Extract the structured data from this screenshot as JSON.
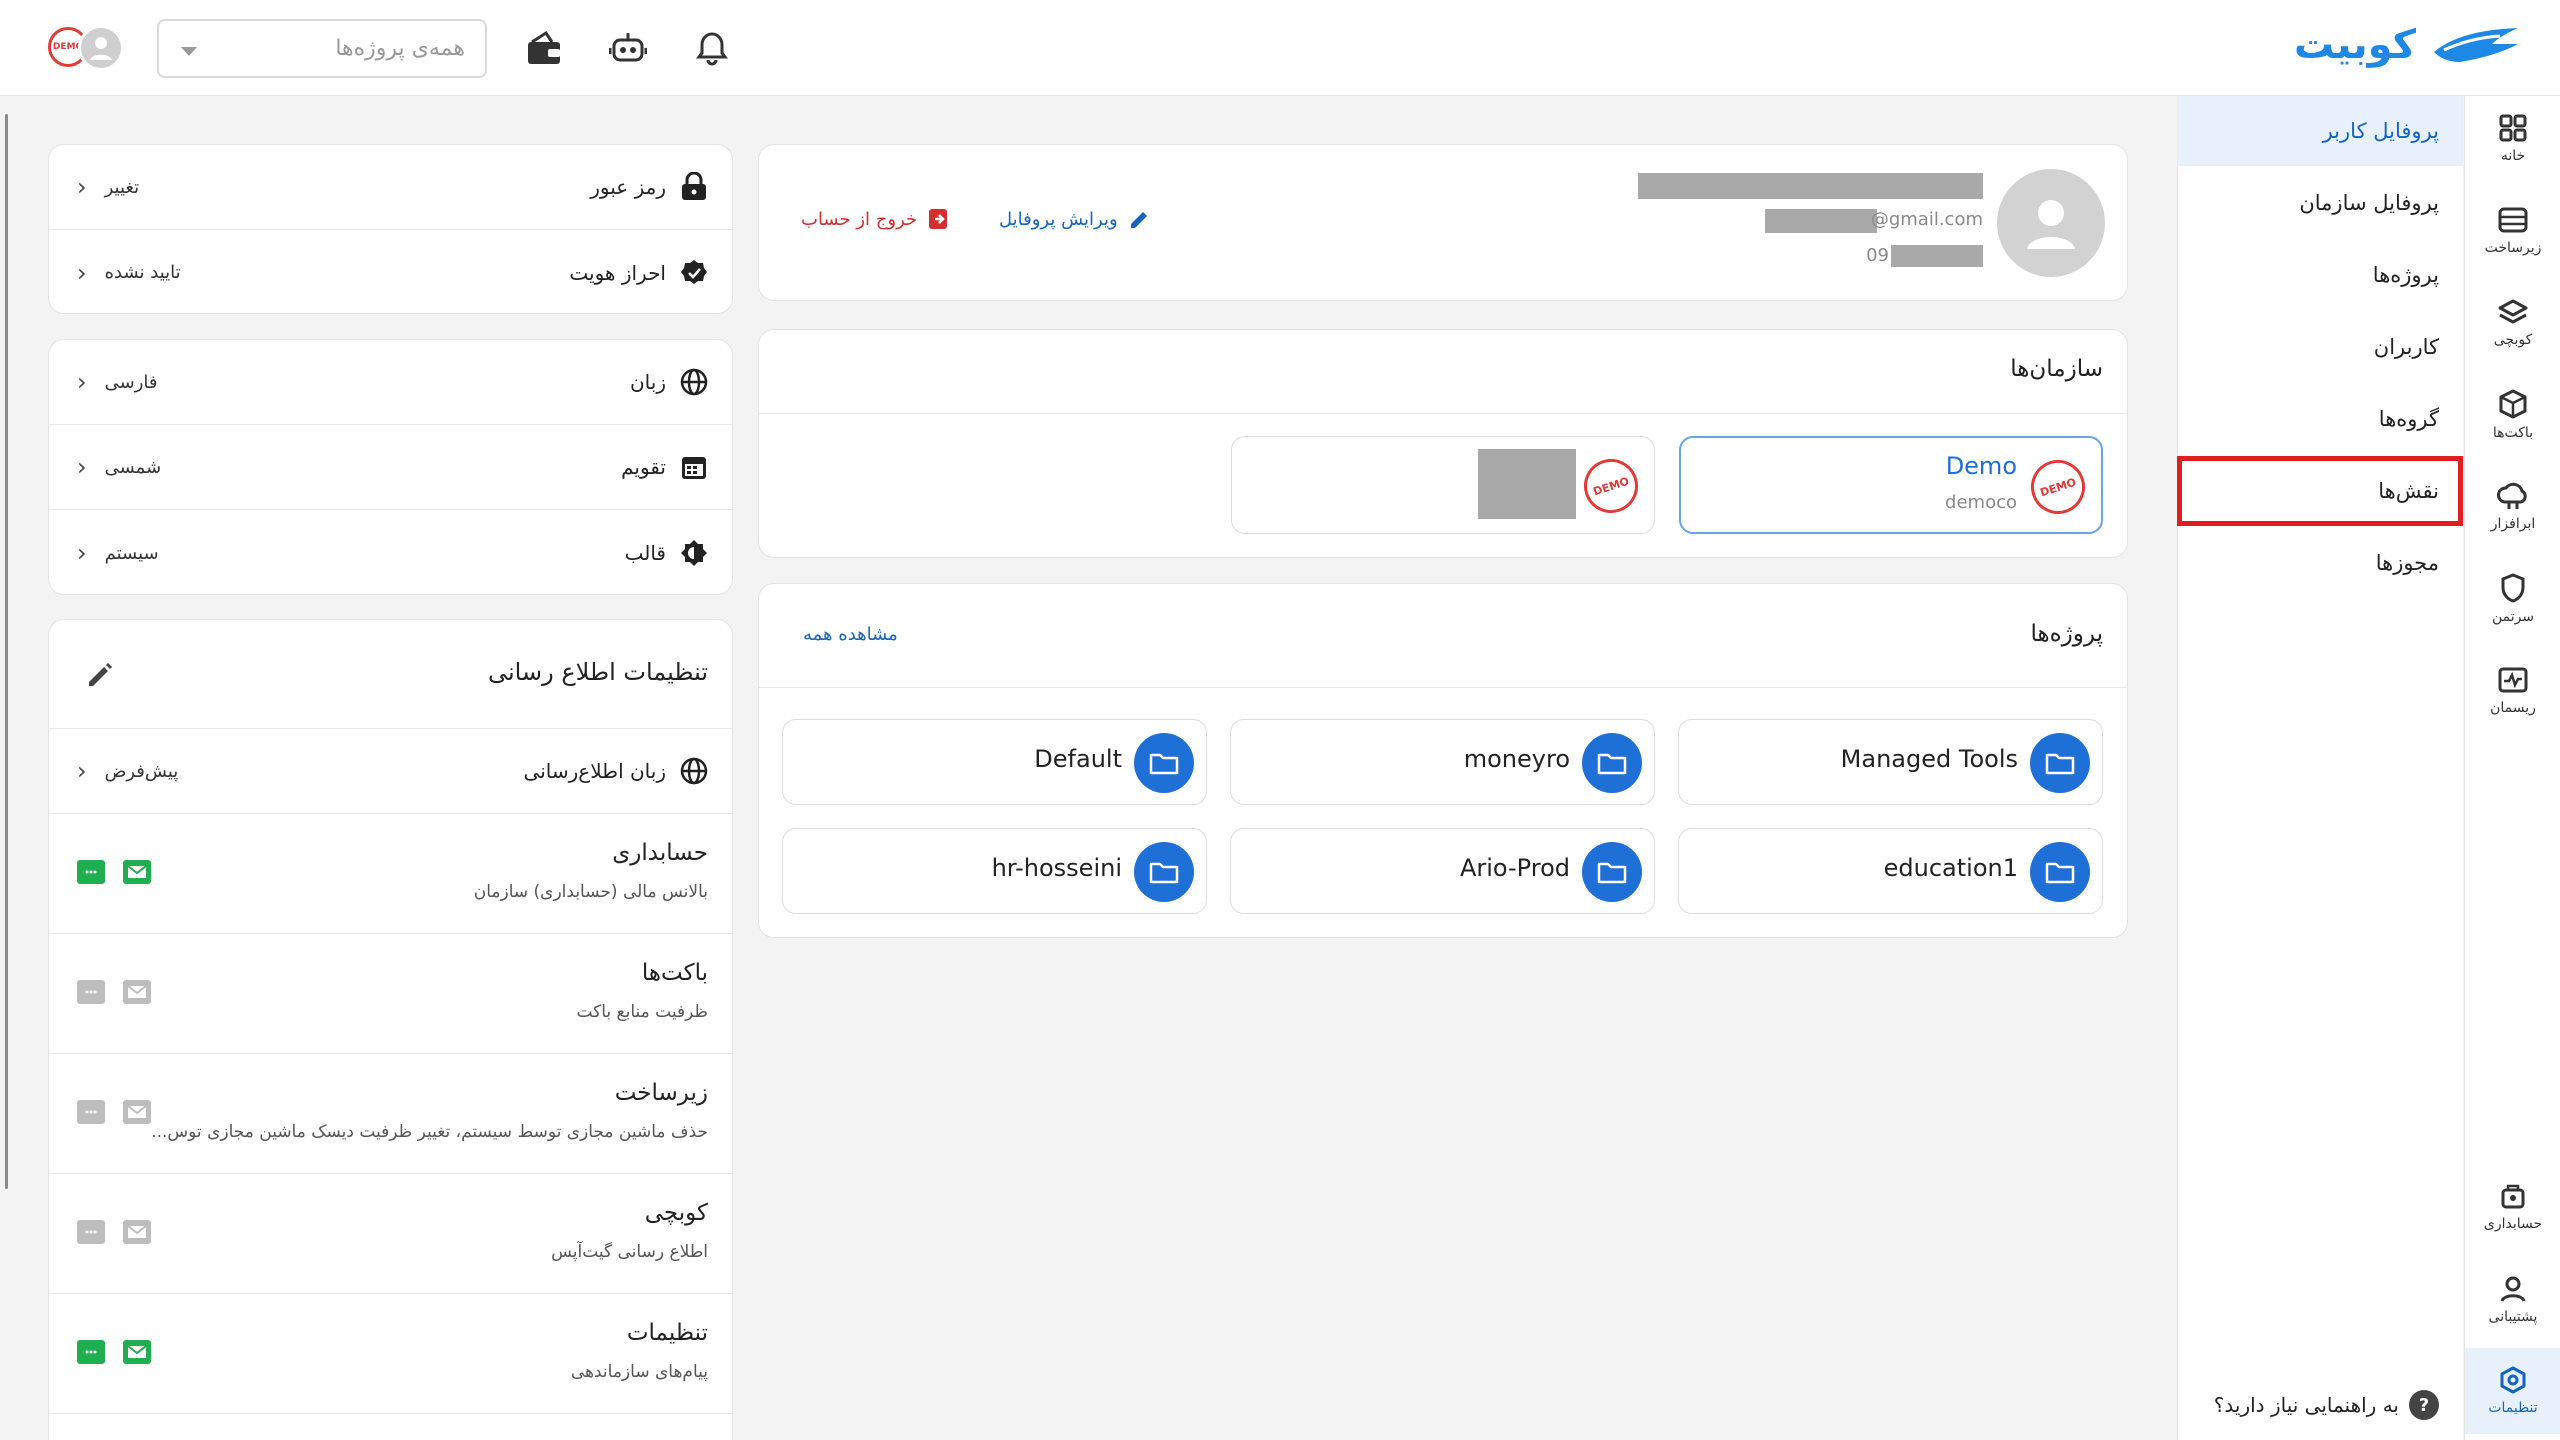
{
  "header": {
    "logo_text": "کوبیت",
    "project_select_placeholder": "همه‌ی پروژه‌ها",
    "avatar_badge_text": "DEMO",
    "icons": [
      "bell-icon",
      "robot-icon",
      "wallet-icon"
    ]
  },
  "rail": {
    "items": [
      {
        "label": "خانه",
        "icon": "grid-icon"
      },
      {
        "label": "زیرساخت",
        "icon": "server-icon"
      },
      {
        "label": "کوبچی",
        "icon": "layers-icon"
      },
      {
        "label": "باکت‌ها",
        "icon": "cube-icon"
      },
      {
        "label": "ابرافزار",
        "icon": "cloud-app-icon"
      },
      {
        "label": "سرتمن",
        "icon": "shield-icon"
      },
      {
        "label": "ریسمان",
        "icon": "pulse-icon"
      },
      {
        "label": "حسابداری",
        "icon": "accounting-icon"
      },
      {
        "label": "پشتیبانی",
        "icon": "support-icon"
      },
      {
        "label": "تنظیمات",
        "icon": "settings-icon"
      }
    ]
  },
  "submenu": {
    "items": [
      {
        "label": "پروفایل کاربر"
      },
      {
        "label": "پروفایل سازمان"
      },
      {
        "label": "پروژه‌ها"
      },
      {
        "label": "کاربران"
      },
      {
        "label": "گروه‌ها"
      },
      {
        "label": "نقش‌ها"
      },
      {
        "label": "مجوزها"
      }
    ],
    "help_label": "به راهنمایی نیاز دارید؟",
    "help_glyph": "?"
  },
  "security": {
    "rows": [
      {
        "label": "رمز عبور",
        "value": "تغییر",
        "icon": "lock-icon"
      },
      {
        "label": "احراز هویت",
        "value": "تایید نشده",
        "icon": "verified-badge-icon"
      }
    ]
  },
  "preferences": {
    "rows": [
      {
        "label": "زبان",
        "value": "فارسی",
        "icon": "globe-icon"
      },
      {
        "label": "تقویم",
        "value": "شمسی",
        "icon": "calendar-icon"
      },
      {
        "label": "قالب",
        "value": "سیستم",
        "icon": "theme-icon"
      }
    ]
  },
  "notifications": {
    "title": "تنظیمات اطلاع رسانی",
    "language_row": {
      "label": "زبان اطلاع‌رسانی",
      "value": "پیش‌فرض"
    },
    "items": [
      {
        "title": "حسابداری",
        "subtitle": "بالانس مالی (حسابداری) سازمان",
        "sms": true,
        "email": true
      },
      {
        "title": "باکت‌ها",
        "subtitle": "ظرفیت منابع باکت",
        "sms": false,
        "email": false
      },
      {
        "title": "زیرساخت",
        "subtitle": "حذف ماشین مجازی توسط سیستم، تغییر ظرفیت دیسک ماشین مجازی توس...",
        "sms": false,
        "email": false
      },
      {
        "title": "کوبچی",
        "subtitle": "اطلاع رسانی گیت‌آپس",
        "sms": false,
        "email": false
      },
      {
        "title": "تنظیمات",
        "subtitle": "پیام‌های سازماندهی",
        "sms": true,
        "email": true
      }
    ]
  },
  "profile": {
    "email_suffix": "@gmail.com",
    "phone_prefix": "09",
    "edit_label": "ویرایش پروفایل",
    "logout_label": "خروج از حساب"
  },
  "organizations": {
    "title": "سازمان‌ها",
    "badge_text": "DEMO",
    "items": [
      {
        "name": "Demo",
        "slug": "democo",
        "selected": true
      },
      {
        "name": "",
        "slug": "",
        "selected": false
      }
    ]
  },
  "projects": {
    "title": "پروژه‌ها",
    "view_all_label": "مشاهده همه",
    "items": [
      "Managed Tools",
      "moneyro",
      "Default",
      "education1",
      "Ario-Prod",
      "hr-hosseini"
    ]
  },
  "colors": {
    "primary": "#1e6fd6",
    "danger": "#e53935",
    "success": "#1fae50",
    "highlight": "#e01e1e"
  }
}
